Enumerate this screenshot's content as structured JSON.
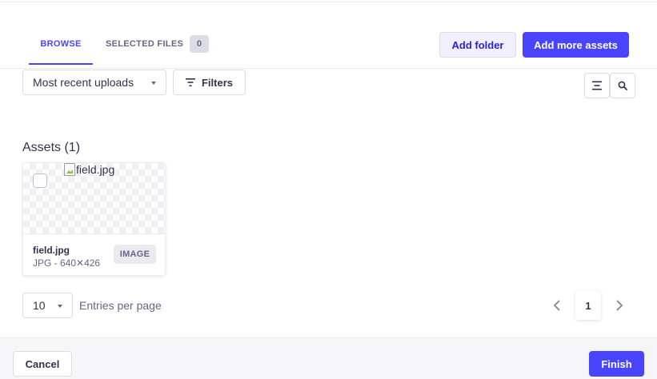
{
  "tabs": {
    "browse_label": "BROWSE",
    "selected_label": "SELECTED FILES",
    "selected_count": "0"
  },
  "header": {
    "add_folder_label": "Add folder",
    "add_assets_label": "Add more assets"
  },
  "toolbar": {
    "sort_value": "Most recent uploads",
    "filters_label": "Filters",
    "filters_icon": "filter-icon",
    "view_icon": "list-view-icon",
    "search_icon": "search-icon"
  },
  "assets": {
    "title": "Assets (1)",
    "items": [
      {
        "image_alt": "field.jpg",
        "name": "field.jpg",
        "meta": "JPG - 640✕426",
        "type": "IMAGE"
      }
    ]
  },
  "pagination": {
    "per_page_value": "10",
    "per_page_label": "Entries per page",
    "current_page": "1"
  },
  "footer": {
    "cancel_label": "Cancel",
    "finish_label": "Finish"
  },
  "colors": {
    "primary": "#4945ff",
    "text": "#32324d",
    "muted": "#666687",
    "border": "#dcdce4"
  }
}
